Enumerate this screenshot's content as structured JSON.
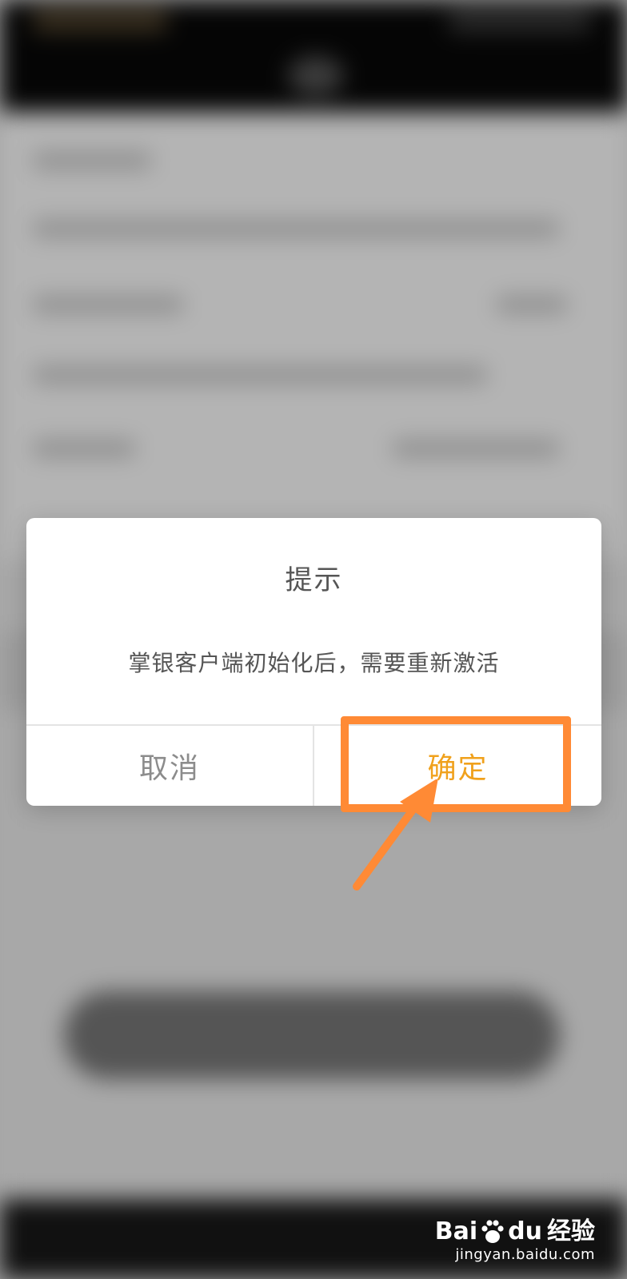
{
  "dialog": {
    "title": "提示",
    "message": "掌银客户端初始化后，需要重新激活",
    "cancel_label": "取消",
    "confirm_label": "确定"
  },
  "colors": {
    "confirm_text": "#f0a11c",
    "cancel_text": "#8c8c8c",
    "annotation": "#ff8a35"
  },
  "watermark": {
    "brand_left": "Bai",
    "brand_right": "du",
    "brand_cn": "经验",
    "url": "jingyan.baidu.com"
  }
}
